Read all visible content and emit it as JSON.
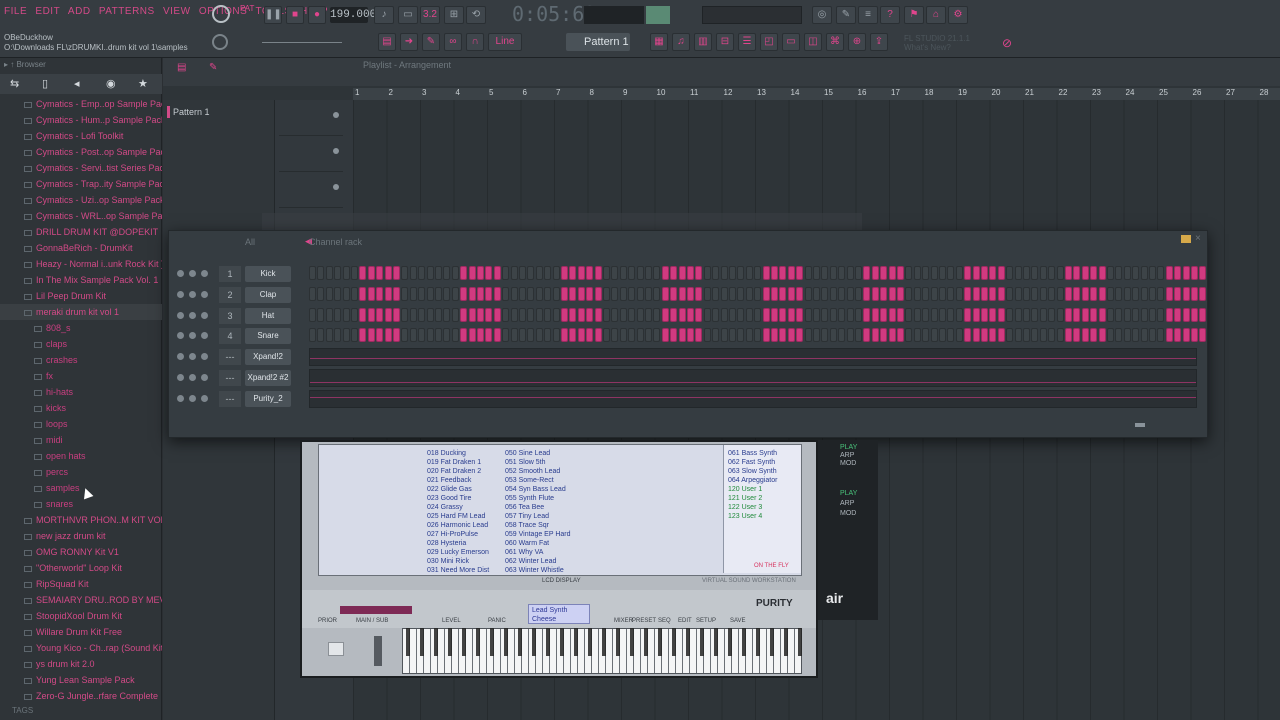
{
  "menu": [
    "FILE",
    "EDIT",
    "ADD",
    "PATTERNS",
    "VIEW",
    "OPTIONS",
    "TOOLS",
    "HELP"
  ],
  "toolbar": {
    "tempo": "199.000",
    "time": "0:05:62",
    "pattern": "Pattern 1",
    "snap": "Line"
  },
  "path": {
    "user": "OBeDuckhow",
    "location": "O:\\Downloads FL\\zDRUMKI..drum kit vol 1\\samples"
  },
  "browser": {
    "title": "Browser",
    "items": [
      {
        "label": "Cymatics - Emp..op Sample Pack",
        "level": 0
      },
      {
        "label": "Cymatics - Hum..p Sample Pack",
        "level": 0
      },
      {
        "label": "Cymatics - Lofi Toolkit",
        "level": 0
      },
      {
        "label": "Cymatics - Post..op Sample Pack",
        "level": 0
      },
      {
        "label": "Cymatics - Servi..tist Series Pack",
        "level": 0
      },
      {
        "label": "Cymatics - Trap..ity Sample Pack",
        "level": 0
      },
      {
        "label": "Cymatics - Uzi..op Sample Pack",
        "level": 0
      },
      {
        "label": "Cymatics - WRL..op Sample Pack",
        "level": 0
      },
      {
        "label": "DRILL DRUM KIT @DOPEKIT",
        "level": 0
      },
      {
        "label": "GonnaBeRich - DrumKit",
        "level": 0
      },
      {
        "label": "Heazy - Normal i..unk Rock Kit )",
        "level": 0
      },
      {
        "label": "In The Mix Sample Pack Vol. 1",
        "level": 0
      },
      {
        "label": "Lil Peep Drum Kit",
        "level": 0
      },
      {
        "label": "meraki drum kit vol 1",
        "level": 0,
        "open": true
      },
      {
        "label": "808_s",
        "level": 1
      },
      {
        "label": "claps",
        "level": 1
      },
      {
        "label": "crashes",
        "level": 1
      },
      {
        "label": "fx",
        "level": 1
      },
      {
        "label": "hi-hats",
        "level": 1
      },
      {
        "label": "kicks",
        "level": 1
      },
      {
        "label": "loops",
        "level": 1
      },
      {
        "label": "midi",
        "level": 1
      },
      {
        "label": "open hats",
        "level": 1
      },
      {
        "label": "percs",
        "level": 1
      },
      {
        "label": "samples",
        "level": 1
      },
      {
        "label": "snares",
        "level": 1
      },
      {
        "label": "MORTHNVR PHON..M KIT VOL. 4",
        "level": 0
      },
      {
        "label": "new jazz drum kit",
        "level": 0
      },
      {
        "label": "OMG RONNY Kit V1",
        "level": 0
      },
      {
        "label": "\"Otherworld\" Loop Kit",
        "level": 0
      },
      {
        "label": "RipSquad Kit",
        "level": 0
      },
      {
        "label": "SEMAIARY DRU..ROD BY MEVO)",
        "level": 0
      },
      {
        "label": "StoopidXool Drum Kit",
        "level": 0
      },
      {
        "label": "Willare Drum Kit Free",
        "level": 0
      },
      {
        "label": "Young Kico - Ch..rap (Sound Kit)",
        "level": 0
      },
      {
        "label": "ys drum kit 2.0",
        "level": 0
      },
      {
        "label": "Yung Lean Sample Pack",
        "level": 0
      },
      {
        "label": "Zero-G Jungle..rfare Complete",
        "level": 0
      }
    ],
    "tags": "TAGS"
  },
  "playlist": {
    "title": "Playlist - Arrangement",
    "pattern": "Pattern 1",
    "ruler": [
      "1",
      "2",
      "3",
      "4",
      "5",
      "6",
      "7",
      "8",
      "9",
      "10",
      "11",
      "12",
      "13",
      "14",
      "15",
      "16",
      "17",
      "18",
      "19",
      "20",
      "21",
      "22",
      "23",
      "24",
      "25",
      "26",
      "27",
      "28"
    ]
  },
  "rack": {
    "title": "Channel rack",
    "filter": "All",
    "channels": [
      {
        "num": "1",
        "name": "Kick",
        "type": "steps"
      },
      {
        "num": "2",
        "name": "Clap",
        "type": "steps"
      },
      {
        "num": "3",
        "name": "Hat",
        "type": "steps"
      },
      {
        "num": "4",
        "name": "Snare",
        "type": "steps"
      },
      {
        "num": "---",
        "name": "Xpand!2",
        "type": "roll"
      },
      {
        "num": "---",
        "name": "Xpand!2 #2",
        "type": "roll"
      },
      {
        "num": "---",
        "name": "Purity_2",
        "type": "roll"
      }
    ],
    "pattern_on": [
      0,
      0,
      0,
      0,
      0,
      0,
      1,
      1,
      1,
      1,
      1,
      0,
      0,
      0,
      0,
      0,
      0,
      0,
      1,
      1,
      1,
      1,
      1,
      0,
      0,
      0,
      0,
      0,
      0,
      0,
      1,
      1,
      1,
      1,
      1,
      0,
      0,
      0,
      0,
      0,
      0,
      0,
      1,
      1,
      1,
      1,
      1,
      0,
      0,
      0,
      0,
      0,
      0,
      0,
      1,
      1,
      1,
      1,
      1,
      0,
      0,
      0,
      0,
      0,
      0,
      0,
      1,
      1,
      1,
      1,
      1,
      0,
      0,
      0,
      0,
      0,
      0,
      0,
      1,
      1,
      1,
      1,
      1,
      0,
      0,
      0,
      0,
      0,
      0,
      0,
      1,
      1,
      1,
      1,
      1,
      0,
      0,
      0,
      0,
      0,
      0,
      0,
      1,
      1,
      1,
      1,
      1
    ]
  },
  "purity": {
    "presets_col1": [
      "018 Ducking",
      "019 Fat Draken 1",
      "020 Fat Draken 2",
      "021 Feedback",
      "022 Glide Gas",
      "023 Good Tire",
      "024 Grassy",
      "025 Hard FM Lead",
      "026 Harmonic Lead",
      "027 Hi-ProPulse",
      "028 Hysteria",
      "029 Lucky Emerson",
      "030 Mini Rick",
      "031 Need More Dist"
    ],
    "presets_col2": [
      "050 Sine Lead",
      "051 Slow 5th",
      "052 Smooth Lead",
      "053 Some-Rect",
      "054 Syn Bass Lead",
      "055 Synth Flute",
      "056 Tea Bee",
      "057 Tiny Lead",
      "058 Trace Sqr",
      "059 Vintage EP Hard",
      "060 Warm Fat",
      "061 Why VA",
      "062 Winter Lead",
      "063 Winter Whistle"
    ],
    "presets_right": [
      "061 Bass Synth",
      "062 Fast Synth",
      "063 Slow Synth",
      "064 Arpeggiator",
      "120 User 1",
      "121 User 2",
      "122 User 3",
      "123 User 4"
    ],
    "on_the_fly": "ON THE FLY",
    "lcd_label": "LCD DISPLAY",
    "workstation_label": "VIRTUAL SOUND WORKSTATION",
    "patch": "Lead Synth Cheese",
    "brand": "PURITY",
    "buttons": [
      "PRIOR",
      "MAIN / SUB",
      "LEVEL",
      "PANIC",
      "MIXER",
      "PRESET",
      "SEQ",
      "EDIT",
      "SETUP",
      "SAVE"
    ],
    "side_buttons": [
      "PLAY",
      "ARP",
      "MOD",
      "PLAY",
      "ARP",
      "MOD"
    ],
    "air": "air"
  },
  "hint": {
    "version": "FL STUDIO 21.1.1",
    "whats_new": "What's New?"
  },
  "colors": {
    "accent": "#d13a80",
    "background": "#2b2f33",
    "panel": "#353c41"
  }
}
